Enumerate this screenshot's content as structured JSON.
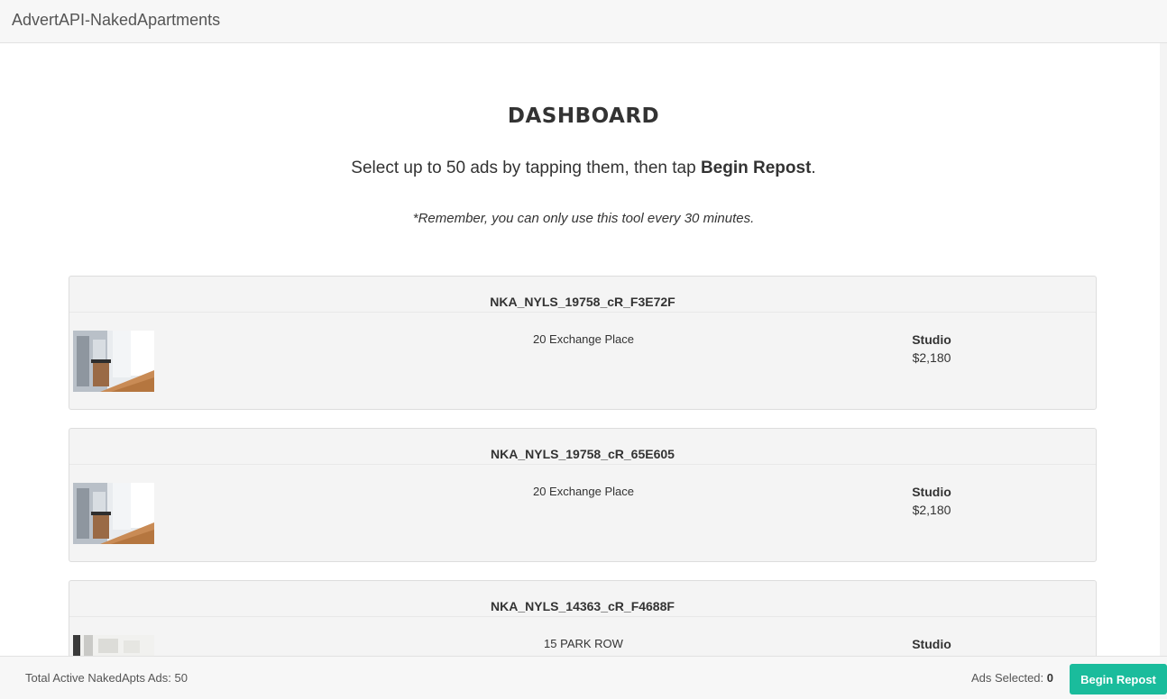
{
  "navbar": {
    "brand": "AdvertAPI-NakedApartments"
  },
  "header": {
    "title": "DASHBOARD",
    "intro_prefix": "Select up to 50 ads by tapping them, then tap ",
    "intro_bold": "Begin Repost",
    "intro_suffix": ".",
    "note": "*Remember, you can only use this tool every 30 minutes."
  },
  "listings": [
    {
      "id": "NKA_NYLS_19758_cR_F3E72F",
      "address": "20 Exchange Place",
      "unit_type": "Studio",
      "price": "$2,180"
    },
    {
      "id": "NKA_NYLS_19758_cR_65E605",
      "address": "20 Exchange Place",
      "unit_type": "Studio",
      "price": "$2,180"
    },
    {
      "id": "NKA_NYLS_14363_cR_F4688F",
      "address": "15 PARK ROW",
      "unit_type": "Studio",
      "price": ""
    }
  ],
  "footer": {
    "total_label": "Total Active NakedApts Ads: 50",
    "selected_label": "Ads Selected: ",
    "selected_count": "0",
    "repost_button": "Begin Repost"
  },
  "colors": {
    "accent": "#1abc9c",
    "card_bg": "#f4f4f4",
    "bar_bg": "#f7f7f7"
  }
}
